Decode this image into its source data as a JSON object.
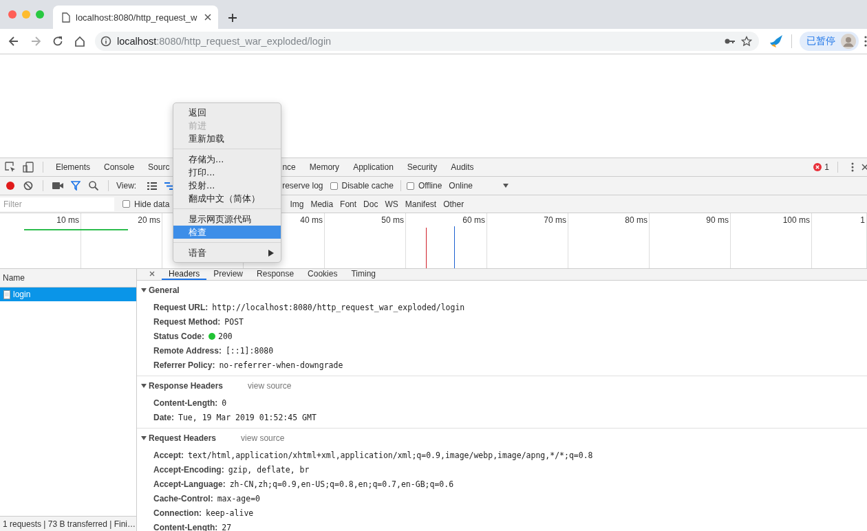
{
  "browser": {
    "tab": {
      "title": "localhost:8080/http_request_w",
      "selected": true
    },
    "nav": [
      {
        "kind": "back",
        "disabled": false
      },
      {
        "kind": "forward",
        "disabled": true
      },
      {
        "kind": "reload",
        "disabled": false
      },
      {
        "kind": "home",
        "disabled": false
      }
    ],
    "address": {
      "host": "localhost",
      "path": ":8080/http_request_war_exploded/login"
    },
    "profile": {
      "label": "已暂停"
    }
  },
  "devtools": {
    "tabs": [
      {
        "label": "Elements"
      },
      {
        "label": "Console"
      },
      {
        "label": "Sourc"
      },
      {
        "label": "nce"
      },
      {
        "label": "Memory"
      },
      {
        "label": "Application"
      },
      {
        "label": "Security"
      },
      {
        "label": "Audits"
      }
    ],
    "error_count": "1",
    "toolbar": {
      "recording": true,
      "view_label": "View:",
      "preserve_log": {
        "label": "reserve log"
      },
      "disable_cache": {
        "label": "Disable cache",
        "checked": false
      },
      "offline": {
        "label": "Offline",
        "checked": false
      },
      "throttling": {
        "value": "Online"
      }
    },
    "filter": {
      "placeholder": "Filter",
      "hide_data": {
        "label": "Hide data",
        "checked": false
      },
      "types": [
        "Img",
        "Media",
        "Font",
        "Doc",
        "WS",
        "Manifest",
        "Other"
      ]
    },
    "timeline": {
      "ticks": [
        "10 ms",
        "20 ms",
        "40 ms",
        "50 ms",
        "60 ms",
        "70 ms",
        "80 ms",
        "90 ms",
        "100 ms",
        "1"
      ]
    },
    "requests": {
      "column": "Name",
      "rows": [
        {
          "name": "login",
          "selected": true
        }
      ],
      "status": "1 requests | 73 B transferred | Fini…"
    },
    "details": {
      "tabs": [
        {
          "label": "Headers",
          "selected": true
        },
        {
          "label": "Preview",
          "selected": false
        },
        {
          "label": "Response",
          "selected": false
        },
        {
          "label": "Cookies",
          "selected": false
        },
        {
          "label": "Timing",
          "selected": false
        }
      ],
      "sections": [
        {
          "title": "General",
          "expanded": true,
          "rows": [
            {
              "key": "Request URL:",
              "value": "http://localhost:8080/http_request_war_exploded/login"
            },
            {
              "key": "Request Method:",
              "value": "POST"
            },
            {
              "key": "Status Code:",
              "value": "200",
              "color": "#21c334"
            },
            {
              "key": "Remote Address:",
              "value": "[::1]:8080"
            },
            {
              "key": "Referrer Policy:",
              "value": "no-referrer-when-downgrade"
            }
          ]
        },
        {
          "title": "Response Headers",
          "expanded": true,
          "link": "view source",
          "rows": [
            {
              "key": "Content-Length:",
              "value": "0"
            },
            {
              "key": "Date:",
              "value": "Tue, 19 Mar 2019 01:52:45 GMT"
            }
          ]
        },
        {
          "title": "Request Headers",
          "expanded": true,
          "link": "view source",
          "rows": [
            {
              "key": "Accept:",
              "value": "text/html,application/xhtml+xml,application/xml;q=0.9,image/webp,image/apng,*/*;q=0.8"
            },
            {
              "key": "Accept-Encoding:",
              "value": "gzip, deflate, br"
            },
            {
              "key": "Accept-Language:",
              "value": "zh-CN,zh;q=0.9,en-US;q=0.8,en;q=0.7,en-GB;q=0.6"
            },
            {
              "key": "Cache-Control:",
              "value": "max-age=0"
            },
            {
              "key": "Connection:",
              "value": "keep-alive"
            },
            {
              "key": "Content-Length:",
              "value": "27"
            }
          ]
        }
      ]
    }
  },
  "context_menu": {
    "items": [
      {
        "kind": "item",
        "label": "返回",
        "disabled": false,
        "selected": false
      },
      {
        "kind": "item",
        "label": "前进",
        "disabled": true,
        "selected": false
      },
      {
        "kind": "item",
        "label": "重新加载",
        "disabled": false,
        "selected": false
      },
      {
        "kind": "separator"
      },
      {
        "kind": "item",
        "label": "存储为...",
        "disabled": false,
        "selected": false
      },
      {
        "kind": "item",
        "label": "打印...",
        "disabled": false,
        "selected": false
      },
      {
        "kind": "item",
        "label": "投射...",
        "disabled": false,
        "selected": false
      },
      {
        "kind": "item",
        "label": "翻成中文（简体）",
        "disabled": false,
        "selected": false
      },
      {
        "kind": "separator"
      },
      {
        "kind": "item",
        "label": "显示网页源代码",
        "disabled": false,
        "selected": false
      },
      {
        "kind": "item",
        "label": "检查",
        "disabled": false,
        "selected": true
      },
      {
        "kind": "separator"
      },
      {
        "kind": "submenu",
        "label": "语音",
        "disabled": false,
        "selected": false
      }
    ]
  }
}
